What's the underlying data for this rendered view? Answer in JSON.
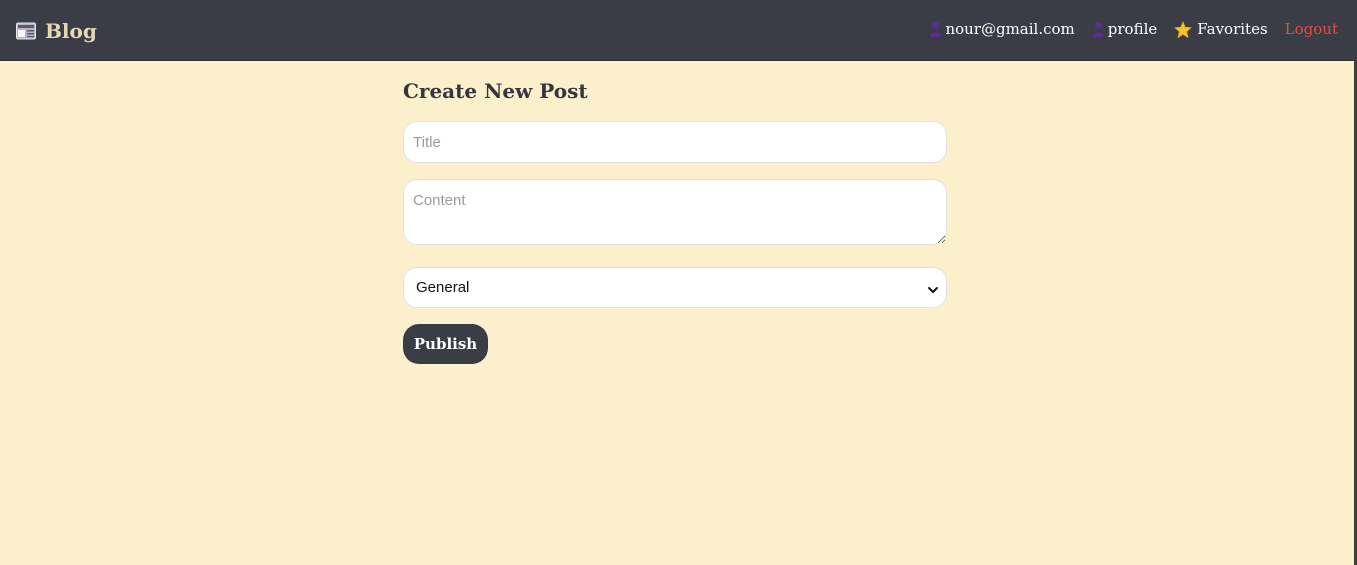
{
  "navbar": {
    "brand": {
      "label": "Blog",
      "icon": "newspaper-icon"
    },
    "items": [
      {
        "label": "nour@gmail.com",
        "icon": "user-icon"
      },
      {
        "label": "profile",
        "icon": "user-icon"
      },
      {
        "label": "Favorites",
        "icon": "star-icon"
      },
      {
        "label": "Logout"
      }
    ]
  },
  "form": {
    "heading": "Create New Post",
    "title_placeholder": "Title",
    "title_value": "",
    "content_placeholder": "Content",
    "content_value": "",
    "category_selected": "General",
    "publish_label": "Publish"
  },
  "colors": {
    "page_bg": "#fcefcb",
    "navbar_bg": "#3a3d46",
    "brand_text": "#e8d7b4",
    "logout": "#e64b4b",
    "user_icon": "#5b2d91",
    "star_icon": "#f4c430"
  }
}
